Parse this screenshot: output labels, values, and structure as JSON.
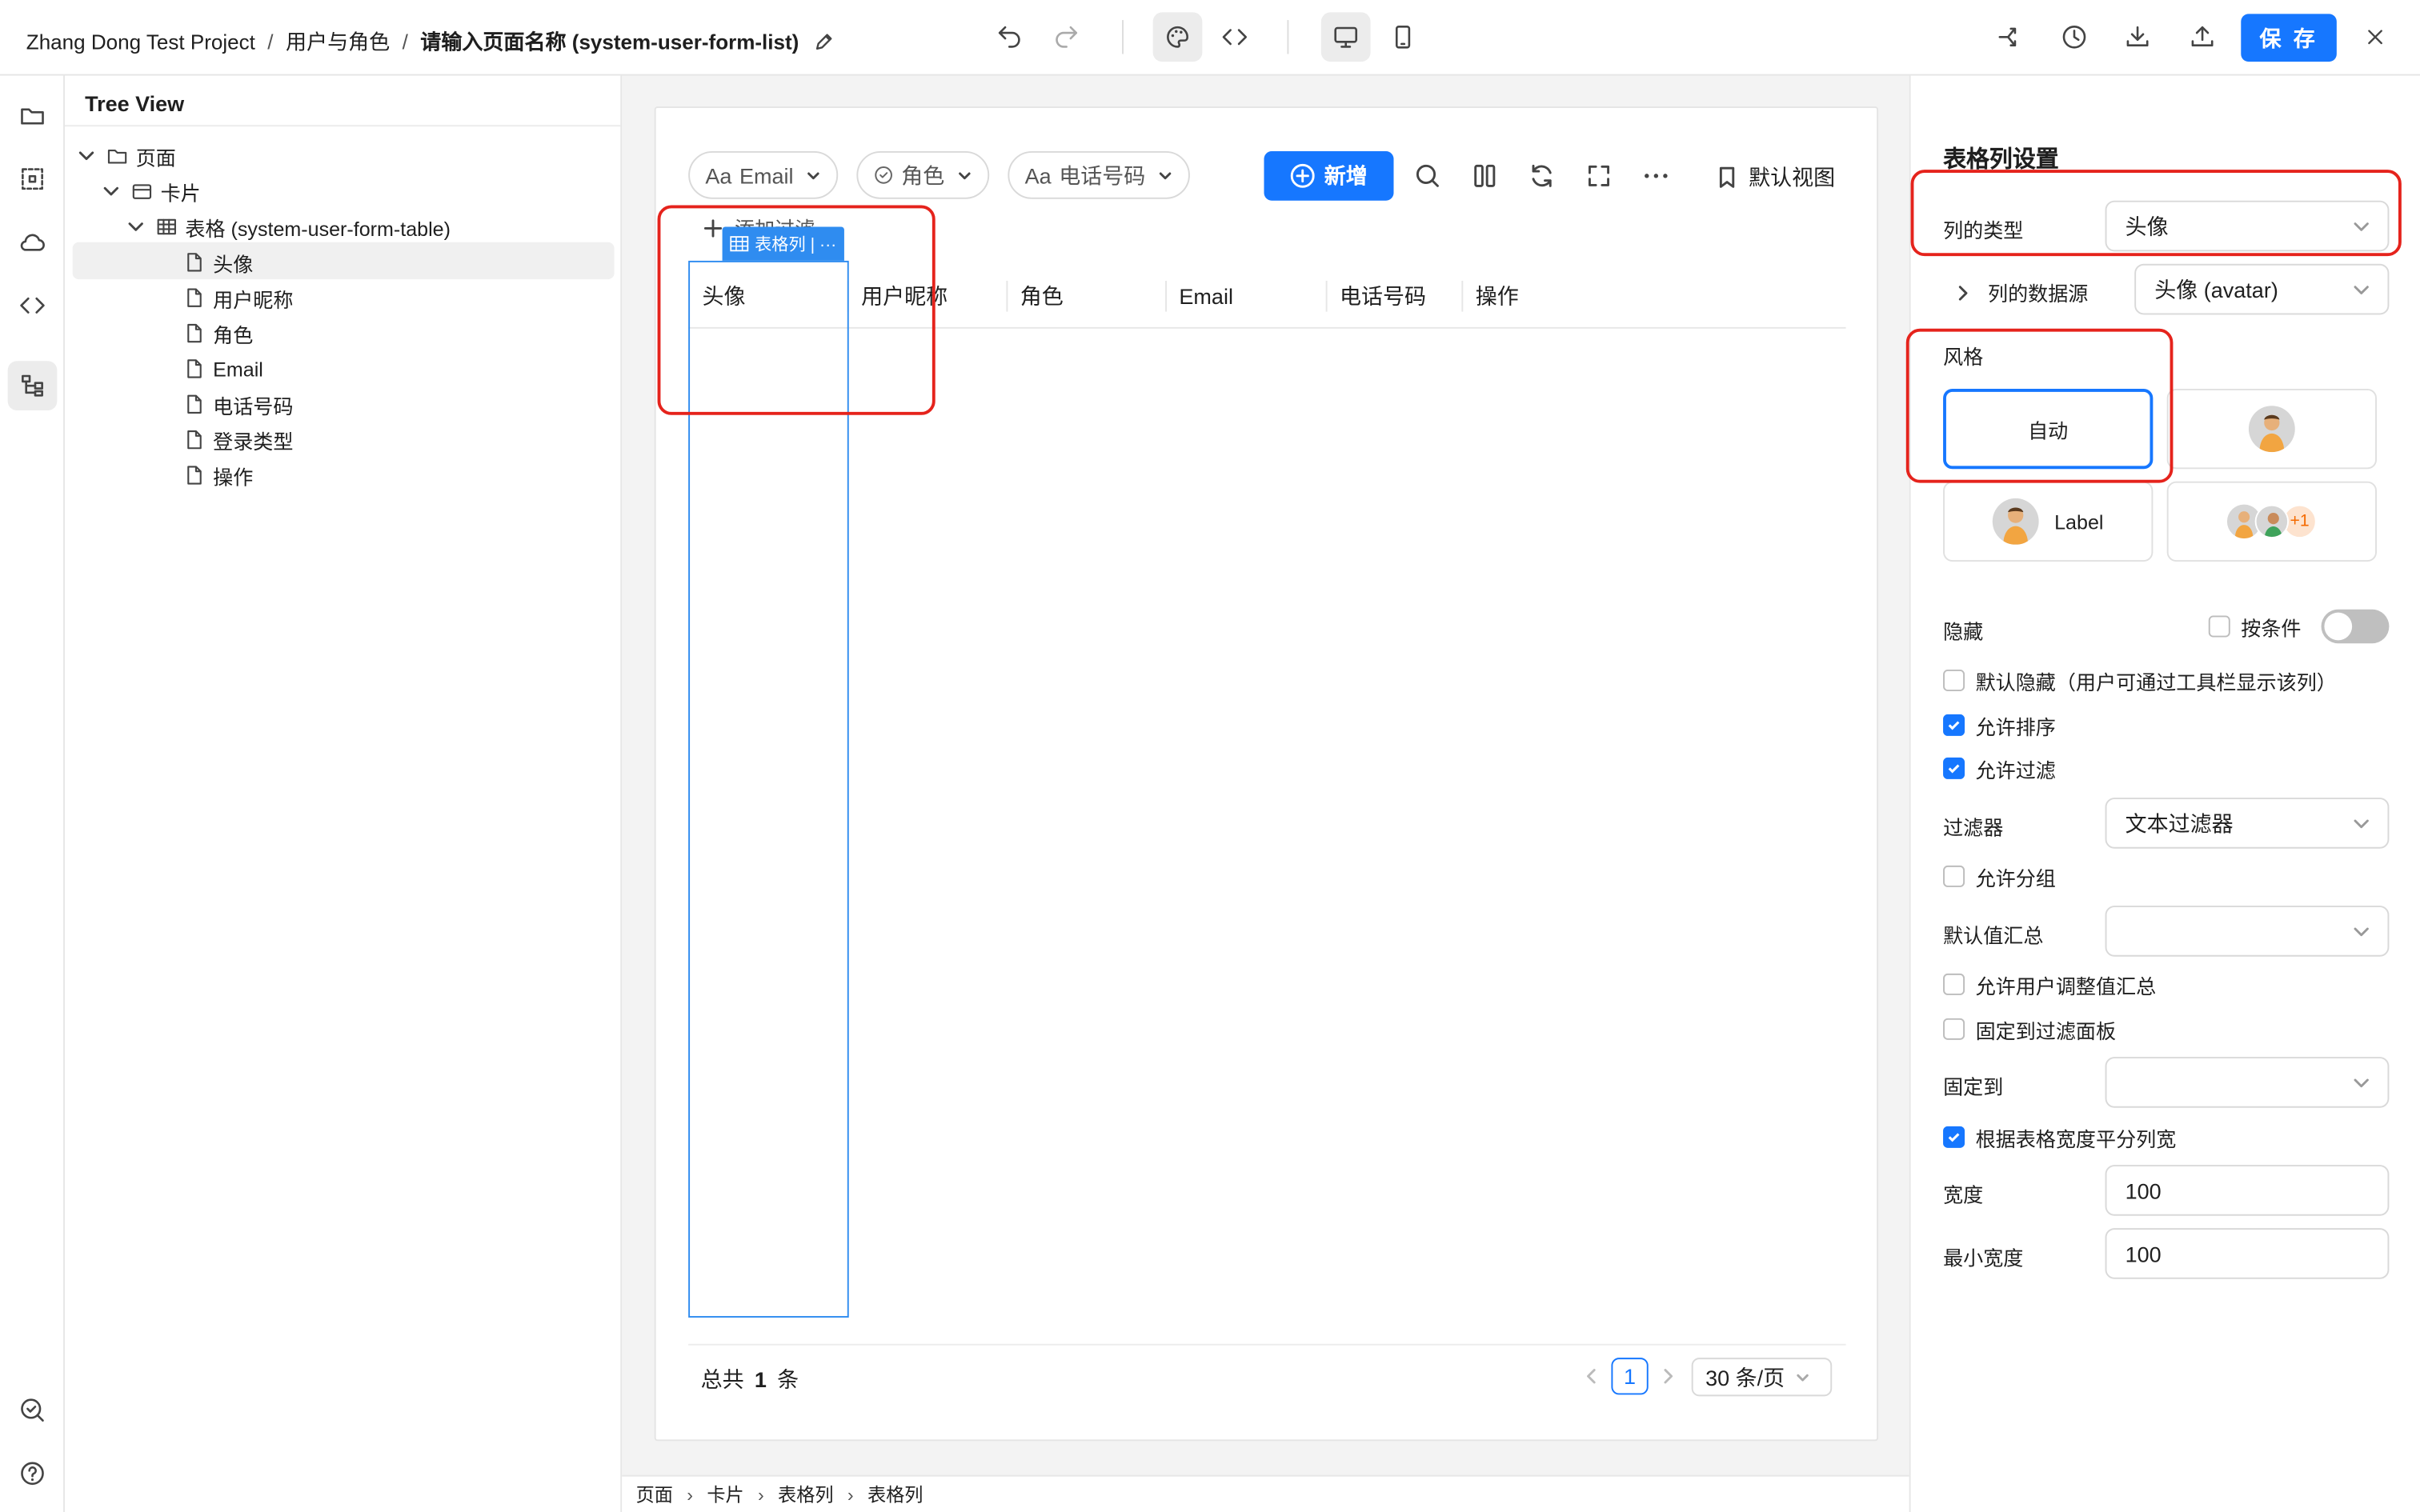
{
  "topbar": {
    "project": "Zhang Dong Test Project",
    "section": "用户与角色",
    "page_name": "请输入页面名称 (system-user-form-list)",
    "save_label": "保 存"
  },
  "tree": {
    "title": "Tree View",
    "nodes": [
      {
        "label": "页面",
        "icon": "folder-icon"
      },
      {
        "label": "卡片",
        "icon": "card-icon"
      },
      {
        "label": "表格 (system-user-form-table)",
        "icon": "table-icon"
      },
      {
        "label": "头像",
        "icon": "file-icon"
      },
      {
        "label": "用户昵称",
        "icon": "file-icon"
      },
      {
        "label": "角色",
        "icon": "file-icon"
      },
      {
        "label": "Email",
        "icon": "file-icon"
      },
      {
        "label": "电话号码",
        "icon": "file-icon"
      },
      {
        "label": "登录类型",
        "icon": "file-icon"
      },
      {
        "label": "操作",
        "icon": "file-icon"
      }
    ]
  },
  "canvas": {
    "filters": [
      {
        "prefix": "Aa",
        "label": "Email"
      },
      {
        "prefix": "",
        "label": "角色"
      },
      {
        "prefix": "Aa",
        "label": "电话号码"
      }
    ],
    "new_label": "新增",
    "default_view_label": "默认视图",
    "add_filter_label": "添加过滤",
    "column_tag": "表格列 | ···",
    "columns": [
      "头像",
      "用户昵称",
      "角色",
      "Email",
      "电话号码",
      "操作"
    ],
    "total_prefix": "总共",
    "total_count": "1",
    "total_suffix": "条",
    "current_page": "1",
    "page_size": "30 条/页"
  },
  "breadcrumb": [
    "页面",
    "卡片",
    "表格列",
    "表格列"
  ],
  "panel": {
    "title": "表格列设置",
    "column_type_label": "列的类型",
    "column_type_value": "头像",
    "datasource_label": "列的数据源",
    "datasource_value": "头像 (avatar)",
    "style_label": "风格",
    "style_auto": "自动",
    "style_label_option": "Label",
    "style_plus": "+1",
    "hidden_label": "隐藏",
    "conditional_label": "按条件",
    "default_hidden": "默认隐藏（用户可通过工具栏显示该列）",
    "allow_sort": "允许排序",
    "allow_filter": "允许过滤",
    "filter_label": "过滤器",
    "filter_value": "文本过滤器",
    "allow_group": "允许分组",
    "agg_label": "默认值汇总",
    "allow_user_agg": "允许用户调整值汇总",
    "pin_filter_panel": "固定到过滤面板",
    "pin_label": "固定到",
    "even_width": "根据表格宽度平分列宽",
    "width_label": "宽度",
    "width_value": "100",
    "min_width_label": "最小宽度",
    "min_width_value": "100"
  },
  "colors": {
    "accent": "#1677ff",
    "highlight": "#e5231c",
    "selection": "#2f8cf0"
  }
}
